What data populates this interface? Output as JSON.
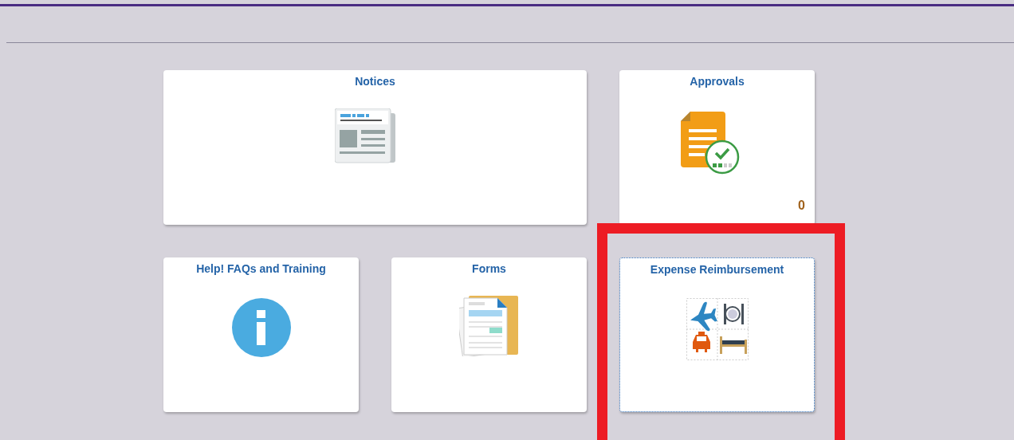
{
  "tiles": [
    {
      "title": "Notices",
      "kind": "news",
      "wide": true,
      "focused": false
    },
    {
      "title": "Approvals",
      "kind": "approvals",
      "count": "0",
      "wide": false,
      "focused": false
    },
    {
      "title": "Help! FAQs and Training",
      "kind": "info",
      "wide": false,
      "focused": false
    },
    {
      "title": "Forms",
      "kind": "forms",
      "wide": false,
      "focused": false
    },
    {
      "title": "Expense Reimbursement",
      "kind": "expense",
      "wide": false,
      "focused": true
    }
  ],
  "annotation": {
    "kind": "frame"
  }
}
